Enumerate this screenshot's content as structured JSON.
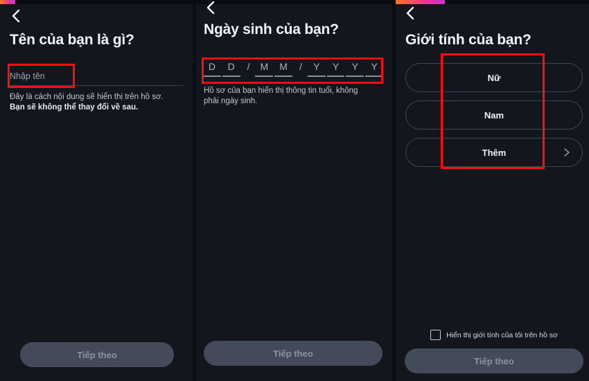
{
  "theme": {
    "background": "#14161e",
    "panel_divider": "#0a0c12",
    "progress_gradient_from": "#f7761f",
    "progress_gradient_to": "#d42ad8",
    "annotation_color": "#fd0d0d",
    "next_button_bg": "#434a59",
    "next_button_text": "#8d929f"
  },
  "screens": [
    {
      "id": "name",
      "progress_percent": 8,
      "back_icon": "chevron-left-icon",
      "title": "Tên của bạn là gì?",
      "input": {
        "placeholder": "Nhập tên",
        "value": ""
      },
      "helper_line1": "Đây là cách nội dung sẽ hiển thị trên hồ sơ.",
      "helper_line2": "Bạn sẽ không thể thay đổi về sau.",
      "next_label": "Tiếp theo"
    },
    {
      "id": "birthday",
      "progress_percent": 0,
      "back_icon": "chevron-left-icon",
      "title": "Ngày sinh của bạn?",
      "date_cells": [
        "D",
        "D",
        "/",
        "M",
        "M",
        "/",
        "Y",
        "Y",
        "Y",
        "Y"
      ],
      "helper_line1": "Hồ sơ của bạn hiển thị thông tin tuổi, không",
      "helper_line2": "phải ngày sinh.",
      "next_label": "Tiếp theo"
    },
    {
      "id": "gender",
      "progress_percent": 25,
      "back_icon": "chevron-left-icon",
      "title": "Giới tính của bạn?",
      "options": [
        {
          "label": "Nữ",
          "has_chevron": false
        },
        {
          "label": "Nam",
          "has_chevron": false
        },
        {
          "label": "Thêm",
          "has_chevron": true,
          "chevron_icon": "chevron-right-icon"
        }
      ],
      "checkbox": {
        "label": "Hiển thị giới tính của tôi trên hồ sơ",
        "checked": false
      },
      "next_label": "Tiếp theo"
    }
  ],
  "annotations": [
    {
      "screen": "name",
      "target": "name-input-field"
    },
    {
      "screen": "birthday",
      "target": "date-of-birth-fields"
    },
    {
      "screen": "gender",
      "target": "gender-options-group"
    }
  ]
}
